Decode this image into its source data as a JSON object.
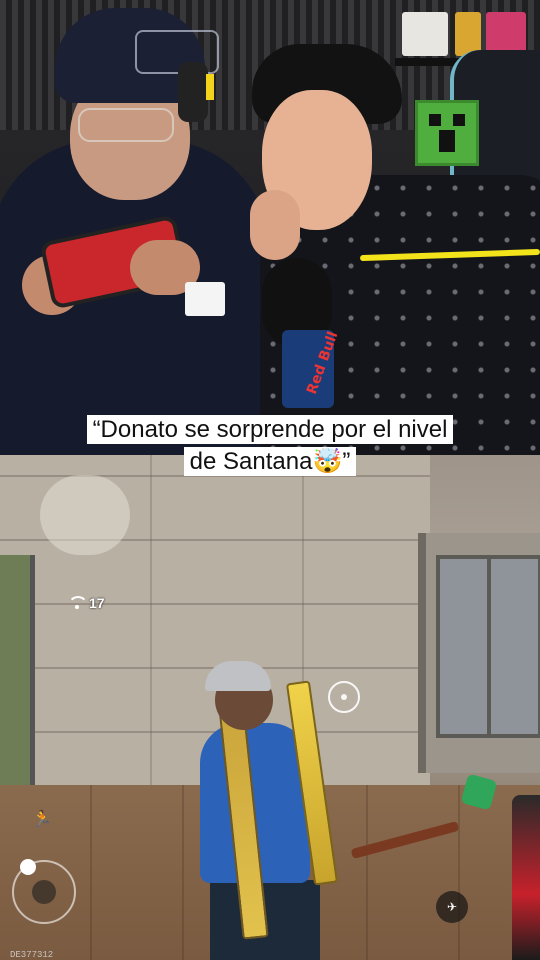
{
  "caption": {
    "line1": "“Donato se sorprende por el nivel",
    "line2": "de Santana🤯”"
  },
  "game_hud": {
    "ping_value": "17",
    "player_id": "DE377312",
    "fire_icon": "aim-icon",
    "move_icon": "run-icon"
  },
  "stream_overlay": {
    "mic_brand": "Red Bull"
  }
}
